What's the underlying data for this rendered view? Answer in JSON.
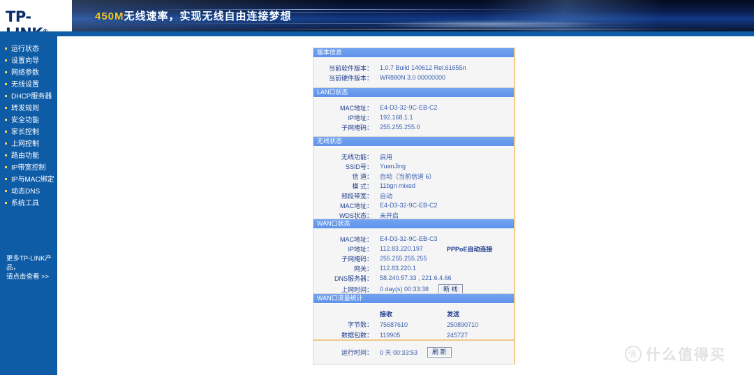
{
  "banner": {
    "brand": "TP-LINK",
    "brand_mark": "®",
    "slogan_speed": "450M",
    "slogan_rest": "无线速率，实现无线自由连接梦想"
  },
  "sidebar": {
    "items": [
      {
        "label": "运行状态"
      },
      {
        "label": "设置向导"
      },
      {
        "label": "网络参数"
      },
      {
        "label": "无线设置"
      },
      {
        "label": "DHCP服务器"
      },
      {
        "label": "转发规则"
      },
      {
        "label": "安全功能"
      },
      {
        "label": "家长控制"
      },
      {
        "label": "上网控制"
      },
      {
        "label": "路由功能"
      },
      {
        "label": "IP带宽控制"
      },
      {
        "label": "IP与MAC绑定"
      },
      {
        "label": "动态DNS"
      },
      {
        "label": "系统工具"
      }
    ],
    "promo_line1": "更多TP-LINK产品，",
    "promo_line2": "请点击查看 >>"
  },
  "panels": {
    "version": {
      "title": "版本信息",
      "rows": [
        {
          "label": "当前软件版本：",
          "value": "1.0.7 Build 140612 Rel.61655n"
        },
        {
          "label": "当前硬件版本：",
          "value": "WR880N 3.0 00000000"
        }
      ]
    },
    "lan": {
      "title": "LAN口状态",
      "rows": [
        {
          "label": "MAC地址：",
          "value": "E4-D3-32-9C-EB-C2"
        },
        {
          "label": "IP地址：",
          "value": "192.168.1.1"
        },
        {
          "label": "子网掩码：",
          "value": "255.255.255.0"
        }
      ]
    },
    "wireless": {
      "title": "无线状态",
      "rows": [
        {
          "label": "无线功能：",
          "value": "启用"
        },
        {
          "label": "SSID号：",
          "value": "YuanJing"
        },
        {
          "label": "信 道：",
          "value": "自动（当前信道 6）"
        },
        {
          "label": "模 式：",
          "value": "11bgn mixed"
        },
        {
          "label": "频段带宽：",
          "value": "自动"
        },
        {
          "label": "MAC地址：",
          "value": "E4-D3-32-9C-EB-C2"
        },
        {
          "label": "WDS状态：",
          "value": "未开启"
        }
      ]
    },
    "wan": {
      "title": "WAN口状态",
      "rows": [
        {
          "label": "MAC地址：",
          "value": "E4-D3-32-9C-EB-C3",
          "extra": ""
        },
        {
          "label": "IP地址：",
          "value": "112.83.220.197",
          "extra": "PPPoE自动连接"
        },
        {
          "label": "子网掩码：",
          "value": "255.255.255.255",
          "extra": ""
        },
        {
          "label": "网关：",
          "value": "112.83.220.1",
          "extra": ""
        },
        {
          "label": "DNS服务器：",
          "value": "58.240.57.33 , 221.6.4.66",
          "extra": ""
        }
      ],
      "uptime_label": "上网时间：",
      "uptime_value": "0 day(s) 00:33:38",
      "disconnect_button": "断 线"
    },
    "traffic": {
      "title": "WAN口流量统计",
      "col_recv": "接收",
      "col_send": "发送",
      "rows": [
        {
          "label": "字节数：",
          "recv": "75687610",
          "send": "250890710"
        },
        {
          "label": "数据包数：",
          "recv": "119905",
          "send": "245727"
        }
      ]
    },
    "runtime": {
      "label": "运行时间：",
      "value": "0 天 00:33:53",
      "refresh_button": "刷 新"
    }
  },
  "watermark": {
    "mark": "值",
    "text": "什么值得买"
  }
}
